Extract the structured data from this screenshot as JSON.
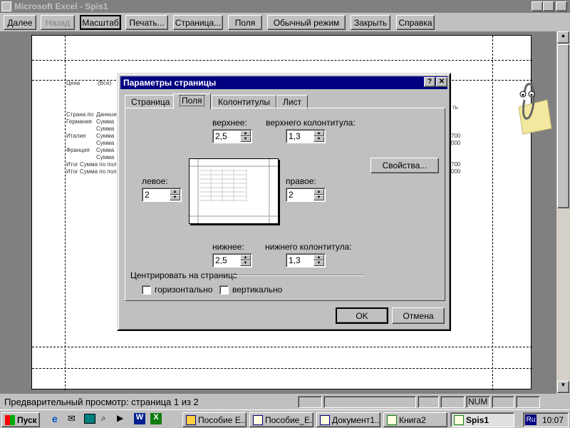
{
  "window": {
    "title": "Microsoft Excel - Spis1"
  },
  "toolbar": {
    "buttons": [
      "Далее",
      "Назад",
      "Масштаб",
      "Печать...",
      "Страница...",
      "Поля",
      "Обычный режим",
      "Закрыть",
      "Справка"
    ]
  },
  "sheet": {
    "cells": [
      "Цена",
      "(Все)",
      "Страна по",
      "Данные",
      "Германия",
      "Сумма",
      "Сумма",
      "Италия",
      "Сумма",
      "Сумма",
      "Франция",
      "Сумма",
      "Сумма",
      "Итог Сумма по пол",
      "Итог Сумма по пол",
      "ть",
      "700",
      "000",
      "700",
      "000"
    ]
  },
  "dialog": {
    "title": "Параметры страницы",
    "tabs": [
      "Страница",
      "Поля",
      "Колонтитулы",
      "Лист"
    ],
    "active_tab": "Поля",
    "labels": {
      "top": "верхнее:",
      "header": "верхнего колонтитула:",
      "left": "левое:",
      "right": "правое:",
      "bottom": "нижнее:",
      "footer": "нижнего колонтитула:",
      "center": "Центрировать на странице",
      "horizontal": "горизонтально",
      "vertical": "вертикально"
    },
    "values": {
      "top": "2,5",
      "header": "1,3",
      "left": "2",
      "right": "2",
      "bottom": "2,5",
      "footer": "1,3"
    },
    "options_button": "Свойства...",
    "ok": "OK",
    "cancel": "Отмена"
  },
  "status": {
    "text": "Предварительный просмотр: страница 1 из 2",
    "num": "NUM"
  },
  "taskbar": {
    "start": "Пуск",
    "items": [
      "Пособие Е...",
      "Пособие_Е...",
      "Документ1...",
      "Книга2",
      "Spis1"
    ],
    "lang": "Ru",
    "time": "10:07"
  }
}
